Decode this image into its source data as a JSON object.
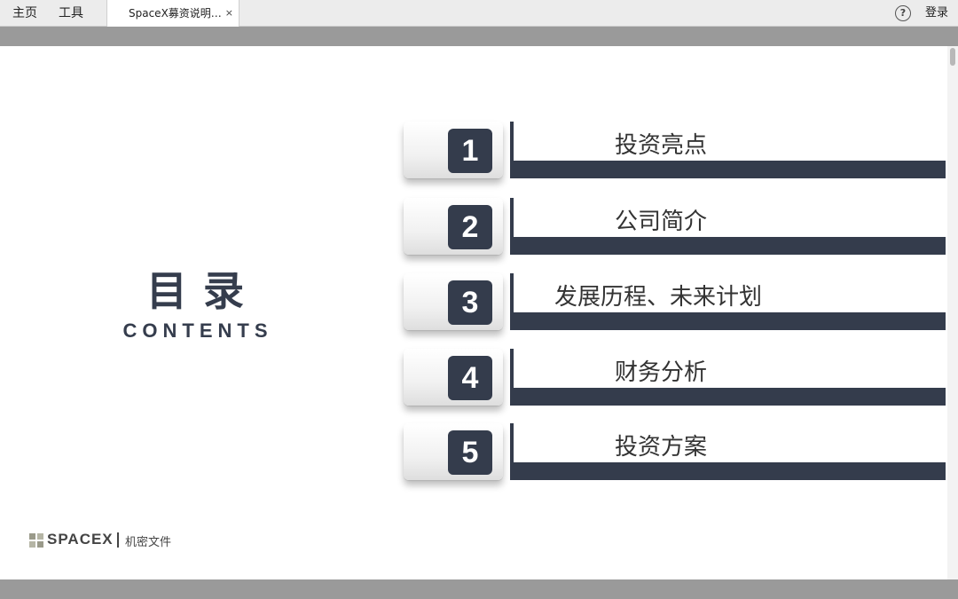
{
  "toolbar": {
    "nav": [
      "主页",
      "工具"
    ],
    "tab_title": "SpaceX募资说明…",
    "tab_close": "×",
    "help": "?",
    "login": "登录"
  },
  "slide": {
    "title_cn": "目录",
    "title_en": "CONTENTS",
    "items": [
      {
        "num": "1",
        "label": "投资亮点"
      },
      {
        "num": "2",
        "label": "公司简介"
      },
      {
        "num": "3",
        "label": "发展历程、未来计划"
      },
      {
        "num": "4",
        "label": "财务分析"
      },
      {
        "num": "5",
        "label": "投资方案"
      }
    ],
    "footer": {
      "brand": "SPACEX",
      "sub": "机密文件"
    }
  },
  "colors": {
    "accent": "#343c4c",
    "page_bg": "#9a9a9a",
    "slide_bg": "#ffffff"
  }
}
